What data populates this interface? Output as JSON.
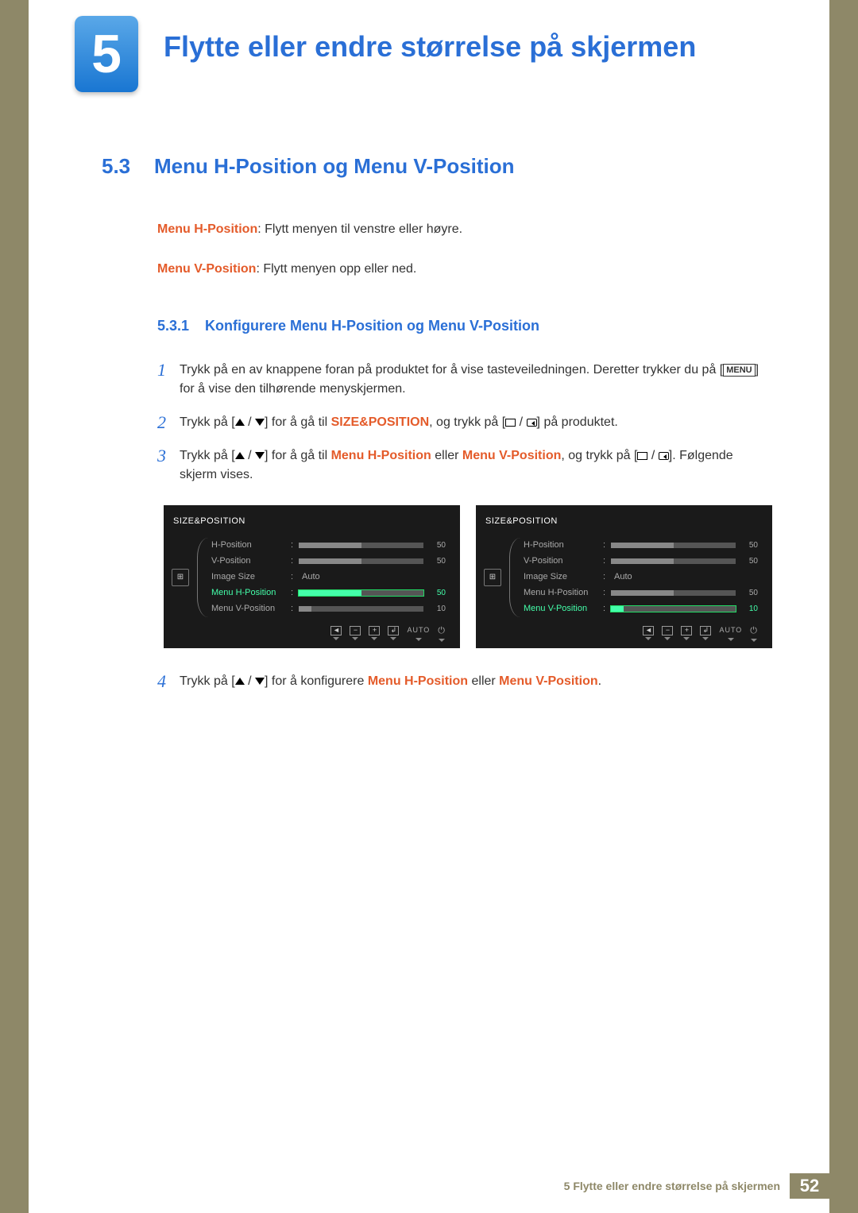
{
  "chapter": {
    "number": "5",
    "title": "Flytte eller endre størrelse på skjermen"
  },
  "section": {
    "number": "5.3",
    "title": "Menu H-Position og Menu V-Position"
  },
  "desc": [
    {
      "term": "Menu H-Position",
      "text": ": Flytt menyen til venstre eller høyre."
    },
    {
      "term": "Menu V-Position",
      "text": ": Flytt menyen opp eller ned."
    }
  ],
  "subsection": {
    "number": "5.3.1",
    "title": "Konfigurere Menu H-Position og Menu V-Position"
  },
  "steps": {
    "1": {
      "a": "Trykk på en av knappene foran på produktet for å vise tasteveiledningen. Deretter trykker du på [",
      "menu": "MENU",
      "b": "] for å vise den tilhørende menyskjermen."
    },
    "2": {
      "a": "Trykk på [",
      "b": "] for å gå til ",
      "em": "SIZE&POSITION",
      "c": ", og trykk på [",
      "d": "] på produktet."
    },
    "3": {
      "a": "Trykk på [",
      "b": "] for å gå til ",
      "em1": "Menu H-Position",
      "mid": " eller ",
      "em2": "Menu V-Position",
      "c": ", og trykk på [",
      "d": "]. Følgende skjerm vises."
    },
    "4": {
      "a": "Trykk på [",
      "b": "] for å konfigurere ",
      "em1": "Menu H-Position",
      "mid": " eller ",
      "em2": "Menu V-Position",
      "c": "."
    }
  },
  "osd": {
    "title": "SIZE&POSITION",
    "rows": [
      {
        "label": "H-Position",
        "value": "50",
        "fill": 50
      },
      {
        "label": "V-Position",
        "value": "50",
        "fill": 50
      },
      {
        "label": "Image Size",
        "value": "Auto",
        "fill": null
      },
      {
        "label": "Menu H-Position",
        "value": "50",
        "fill": 50
      },
      {
        "label": "Menu V-Position",
        "value": "10",
        "fill": 10
      }
    ],
    "selected_left_index": 3,
    "selected_right_index": 4,
    "auto_label": "AUTO"
  },
  "footer": {
    "text": "5 Flytte eller endre størrelse på skjermen",
    "page": "52"
  }
}
